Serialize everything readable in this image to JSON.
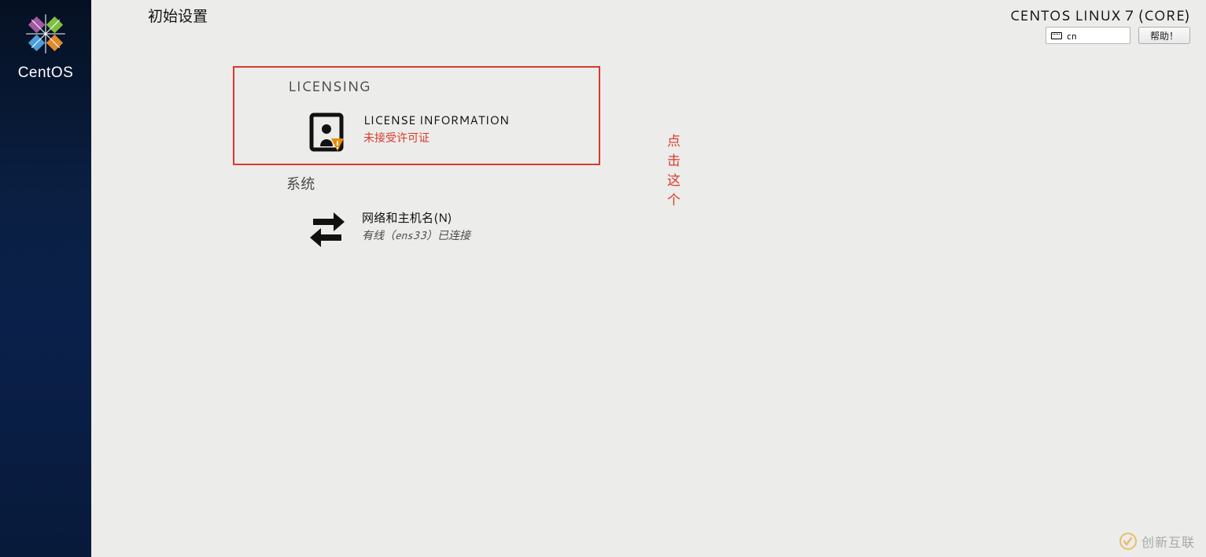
{
  "sidebar": {
    "brand": "CentOS"
  },
  "header": {
    "title": "初始设置",
    "os": "CENTOS LINUX 7 (CORE)",
    "lang_code": "cn",
    "help": "帮助！"
  },
  "sections": {
    "licensing": {
      "header": "LICENSING",
      "spoke_title": "LICENSE INFORMATION",
      "spoke_status": "未接受许可证"
    },
    "system": {
      "header": "系统",
      "spoke_title": "网络和主机名(N)",
      "spoke_status": "有线（ens33）已连接"
    }
  },
  "annotation": "点击这个",
  "watermark": "创新互联"
}
